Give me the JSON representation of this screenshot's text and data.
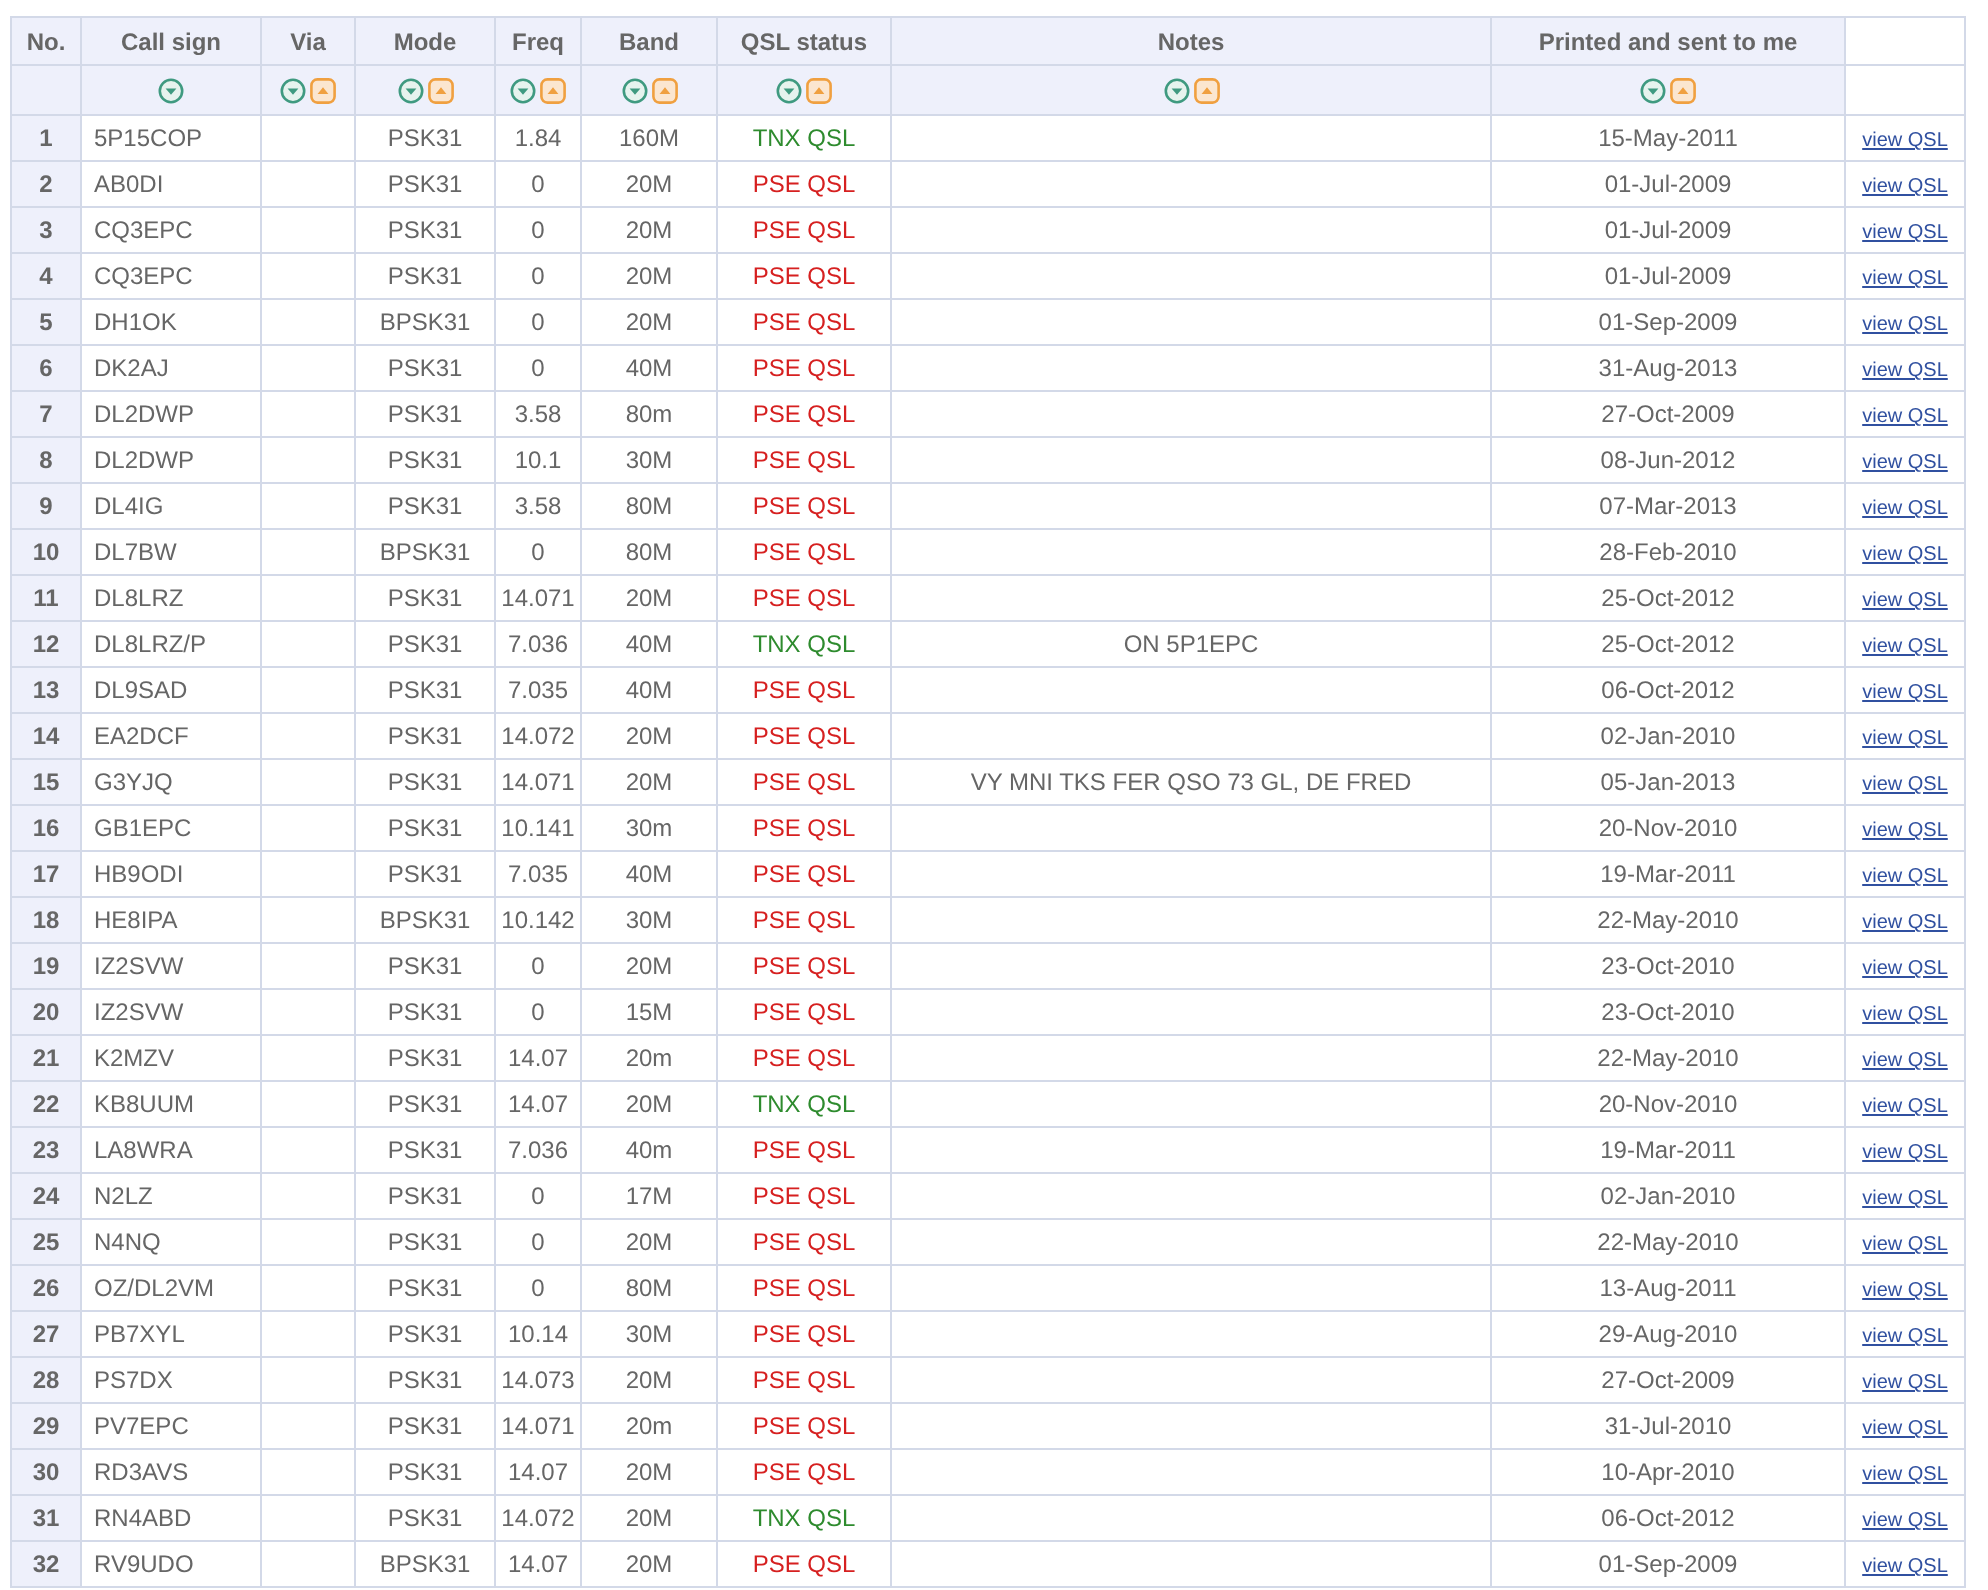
{
  "table": {
    "columns": [
      {
        "header": "No."
      },
      {
        "header": "Call sign",
        "sort": [
          {
            "kind": "down"
          }
        ]
      },
      {
        "header": "Via",
        "sort": [
          {
            "kind": "down"
          },
          {
            "kind": "up"
          }
        ]
      },
      {
        "header": "Mode",
        "sort": [
          {
            "kind": "down"
          },
          {
            "kind": "up"
          }
        ]
      },
      {
        "header": "Freq",
        "sort": [
          {
            "kind": "down"
          },
          {
            "kind": "up"
          }
        ]
      },
      {
        "header": "Band",
        "sort": [
          {
            "kind": "down"
          },
          {
            "kind": "up"
          }
        ]
      },
      {
        "header": "QSL status",
        "sort": [
          {
            "kind": "down"
          },
          {
            "kind": "up"
          }
        ]
      },
      {
        "header": "Notes",
        "sort": [
          {
            "kind": "down"
          },
          {
            "kind": "up"
          }
        ]
      },
      {
        "header": "Printed and sent to me",
        "sort": [
          {
            "kind": "down"
          },
          {
            "kind": "up"
          }
        ]
      },
      {}
    ],
    "rows": [
      {
        "no": "1",
        "call_sign": "5P15COP",
        "mode": "PSK31",
        "freq": "1.84",
        "band": "160M",
        "qsl": {
          "text": "TNX QSL",
          "kind": "tnx"
        },
        "date": "15-May-2011",
        "link": "view QSL"
      },
      {
        "no": "2",
        "call_sign": "AB0DI",
        "mode": "PSK31",
        "freq": "0",
        "band": "20M",
        "qsl": {
          "text": "PSE QSL",
          "kind": "pse"
        },
        "date": "01-Jul-2009",
        "link": "view QSL"
      },
      {
        "no": "3",
        "call_sign": "CQ3EPC",
        "mode": "PSK31",
        "freq": "0",
        "band": "20M",
        "qsl": {
          "text": "PSE QSL",
          "kind": "pse"
        },
        "date": "01-Jul-2009",
        "link": "view QSL"
      },
      {
        "no": "4",
        "call_sign": "CQ3EPC",
        "mode": "PSK31",
        "freq": "0",
        "band": "20M",
        "qsl": {
          "text": "PSE QSL",
          "kind": "pse"
        },
        "date": "01-Jul-2009",
        "link": "view QSL"
      },
      {
        "no": "5",
        "call_sign": "DH1OK",
        "mode": "BPSK31",
        "freq": "0",
        "band": "20M",
        "qsl": {
          "text": "PSE QSL",
          "kind": "pse"
        },
        "date": "01-Sep-2009",
        "link": "view QSL"
      },
      {
        "no": "6",
        "call_sign": "DK2AJ",
        "mode": "PSK31",
        "freq": "0",
        "band": "40M",
        "qsl": {
          "text": "PSE QSL",
          "kind": "pse"
        },
        "date": "31-Aug-2013",
        "link": "view QSL"
      },
      {
        "no": "7",
        "call_sign": "DL2DWP",
        "mode": "PSK31",
        "freq": "3.58",
        "band": "80m",
        "qsl": {
          "text": "PSE QSL",
          "kind": "pse"
        },
        "date": "27-Oct-2009",
        "link": "view QSL"
      },
      {
        "no": "8",
        "call_sign": "DL2DWP",
        "mode": "PSK31",
        "freq": "10.1",
        "band": "30M",
        "qsl": {
          "text": "PSE QSL",
          "kind": "pse"
        },
        "date": "08-Jun-2012",
        "link": "view QSL"
      },
      {
        "no": "9",
        "call_sign": "DL4IG",
        "mode": "PSK31",
        "freq": "3.58",
        "band": "80M",
        "qsl": {
          "text": "PSE QSL",
          "kind": "pse"
        },
        "date": "07-Mar-2013",
        "link": "view QSL"
      },
      {
        "no": "10",
        "call_sign": "DL7BW",
        "mode": "BPSK31",
        "freq": "0",
        "band": "80M",
        "qsl": {
          "text": "PSE QSL",
          "kind": "pse"
        },
        "date": "28-Feb-2010",
        "link": "view QSL"
      },
      {
        "no": "11",
        "call_sign": "DL8LRZ",
        "mode": "PSK31",
        "freq": "14.071",
        "band": "20M",
        "qsl": {
          "text": "PSE QSL",
          "kind": "pse"
        },
        "date": "25-Oct-2012",
        "link": "view QSL"
      },
      {
        "no": "12",
        "call_sign": "DL8LRZ/P",
        "mode": "PSK31",
        "freq": "7.036",
        "band": "40M",
        "qsl": {
          "text": "TNX QSL",
          "kind": "tnx"
        },
        "notes": "ON 5P1EPC",
        "date": "25-Oct-2012",
        "link": "view QSL"
      },
      {
        "no": "13",
        "call_sign": "DL9SAD",
        "mode": "PSK31",
        "freq": "7.035",
        "band": "40M",
        "qsl": {
          "text": "PSE QSL",
          "kind": "pse"
        },
        "date": "06-Oct-2012",
        "link": "view QSL"
      },
      {
        "no": "14",
        "call_sign": "EA2DCF",
        "mode": "PSK31",
        "freq": "14.072",
        "band": "20M",
        "qsl": {
          "text": "PSE QSL",
          "kind": "pse"
        },
        "date": "02-Jan-2010",
        "link": "view QSL"
      },
      {
        "no": "15",
        "call_sign": "G3YJQ",
        "mode": "PSK31",
        "freq": "14.071",
        "band": "20M",
        "qsl": {
          "text": "PSE QSL",
          "kind": "pse"
        },
        "notes": "VY MNI TKS FER QSO 73 GL, DE FRED",
        "date": "05-Jan-2013",
        "link": "view QSL"
      },
      {
        "no": "16",
        "call_sign": "GB1EPC",
        "mode": "PSK31",
        "freq": "10.141",
        "band": "30m",
        "qsl": {
          "text": "PSE QSL",
          "kind": "pse"
        },
        "date": "20-Nov-2010",
        "link": "view QSL"
      },
      {
        "no": "17",
        "call_sign": "HB9ODI",
        "mode": "PSK31",
        "freq": "7.035",
        "band": "40M",
        "qsl": {
          "text": "PSE QSL",
          "kind": "pse"
        },
        "date": "19-Mar-2011",
        "link": "view QSL"
      },
      {
        "no": "18",
        "call_sign": "HE8IPA",
        "mode": "BPSK31",
        "freq": "10.142",
        "band": "30M",
        "qsl": {
          "text": "PSE QSL",
          "kind": "pse"
        },
        "date": "22-May-2010",
        "link": "view QSL"
      },
      {
        "no": "19",
        "call_sign": "IZ2SVW",
        "mode": "PSK31",
        "freq": "0",
        "band": "20M",
        "qsl": {
          "text": "PSE QSL",
          "kind": "pse"
        },
        "date": "23-Oct-2010",
        "link": "view QSL"
      },
      {
        "no": "20",
        "call_sign": "IZ2SVW",
        "mode": "PSK31",
        "freq": "0",
        "band": "15M",
        "qsl": {
          "text": "PSE QSL",
          "kind": "pse"
        },
        "date": "23-Oct-2010",
        "link": "view QSL"
      },
      {
        "no": "21",
        "call_sign": "K2MZV",
        "mode": "PSK31",
        "freq": "14.07",
        "band": "20m",
        "qsl": {
          "text": "PSE QSL",
          "kind": "pse"
        },
        "date": "22-May-2010",
        "link": "view QSL"
      },
      {
        "no": "22",
        "call_sign": "KB8UUM",
        "mode": "PSK31",
        "freq": "14.07",
        "band": "20M",
        "qsl": {
          "text": "TNX QSL",
          "kind": "tnx"
        },
        "date": "20-Nov-2010",
        "link": "view QSL"
      },
      {
        "no": "23",
        "call_sign": "LA8WRA",
        "mode": "PSK31",
        "freq": "7.036",
        "band": "40m",
        "qsl": {
          "text": "PSE QSL",
          "kind": "pse"
        },
        "date": "19-Mar-2011",
        "link": "view QSL"
      },
      {
        "no": "24",
        "call_sign": "N2LZ",
        "mode": "PSK31",
        "freq": "0",
        "band": "17M",
        "qsl": {
          "text": "PSE QSL",
          "kind": "pse"
        },
        "date": "02-Jan-2010",
        "link": "view QSL"
      },
      {
        "no": "25",
        "call_sign": "N4NQ",
        "mode": "PSK31",
        "freq": "0",
        "band": "20M",
        "qsl": {
          "text": "PSE QSL",
          "kind": "pse"
        },
        "date": "22-May-2010",
        "link": "view QSL"
      },
      {
        "no": "26",
        "call_sign": "OZ/DL2VM",
        "mode": "PSK31",
        "freq": "0",
        "band": "80M",
        "qsl": {
          "text": "PSE QSL",
          "kind": "pse"
        },
        "date": "13-Aug-2011",
        "link": "view QSL"
      },
      {
        "no": "27",
        "call_sign": "PB7XYL",
        "mode": "PSK31",
        "freq": "10.14",
        "band": "30M",
        "qsl": {
          "text": "PSE QSL",
          "kind": "pse"
        },
        "date": "29-Aug-2010",
        "link": "view QSL"
      },
      {
        "no": "28",
        "call_sign": "PS7DX",
        "mode": "PSK31",
        "freq": "14.073",
        "band": "20M",
        "qsl": {
          "text": "PSE QSL",
          "kind": "pse"
        },
        "date": "27-Oct-2009",
        "link": "view QSL"
      },
      {
        "no": "29",
        "call_sign": "PV7EPC",
        "mode": "PSK31",
        "freq": "14.071",
        "band": "20m",
        "qsl": {
          "text": "PSE QSL",
          "kind": "pse"
        },
        "date": "31-Jul-2010",
        "link": "view QSL"
      },
      {
        "no": "30",
        "call_sign": "RD3AVS",
        "mode": "PSK31",
        "freq": "14.07",
        "band": "20M",
        "qsl": {
          "text": "PSE QSL",
          "kind": "pse"
        },
        "date": "10-Apr-2010",
        "link": "view QSL"
      },
      {
        "no": "31",
        "call_sign": "RN4ABD",
        "mode": "PSK31",
        "freq": "14.072",
        "band": "20M",
        "qsl": {
          "text": "TNX QSL",
          "kind": "tnx"
        },
        "date": "06-Oct-2012",
        "link": "view QSL"
      },
      {
        "no": "32",
        "call_sign": "RV9UDO",
        "mode": "BPSK31",
        "freq": "14.07",
        "band": "20M",
        "qsl": {
          "text": "PSE QSL",
          "kind": "pse"
        },
        "date": "01-Sep-2009",
        "link": "view QSL"
      }
    ]
  }
}
